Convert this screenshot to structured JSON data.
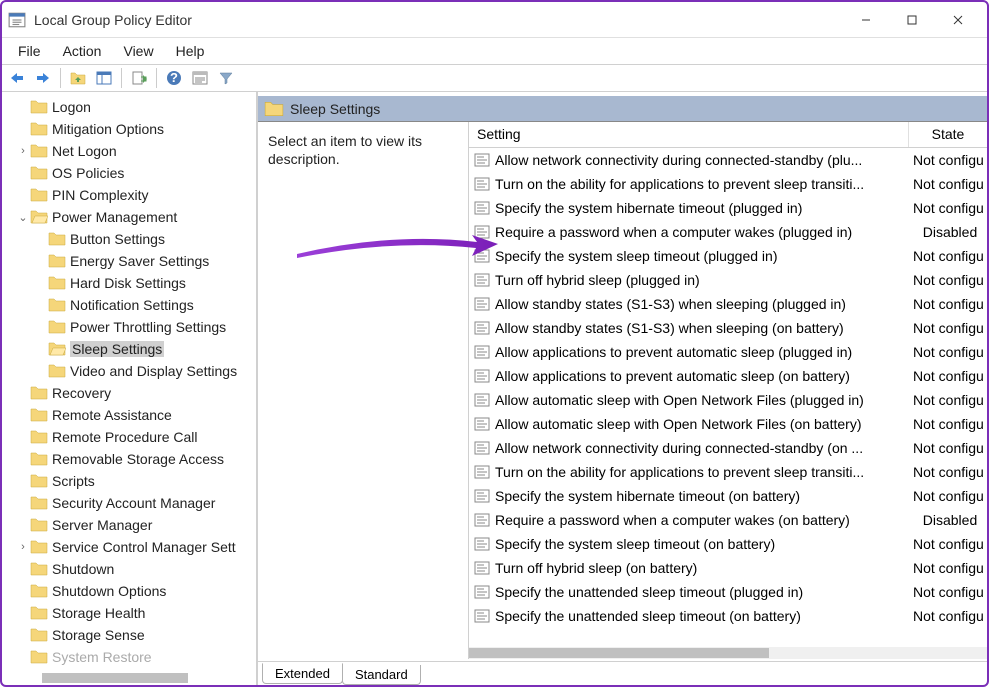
{
  "window": {
    "title": "Local Group Policy Editor"
  },
  "menu": [
    "File",
    "Action",
    "View",
    "Help"
  ],
  "section": {
    "title": "Sleep Settings",
    "description": "Select an item to view its description."
  },
  "columns": {
    "setting": "Setting",
    "state": "State"
  },
  "tree": [
    {
      "label": "Logon",
      "level": 1
    },
    {
      "label": "Mitigation Options",
      "level": 1
    },
    {
      "label": "Net Logon",
      "level": 1,
      "expand": "›"
    },
    {
      "label": "OS Policies",
      "level": 1
    },
    {
      "label": "PIN Complexity",
      "level": 1
    },
    {
      "label": "Power Management",
      "level": 1,
      "expand": "⌄",
      "open": true
    },
    {
      "label": "Button Settings",
      "level": 2
    },
    {
      "label": "Energy Saver Settings",
      "level": 2
    },
    {
      "label": "Hard Disk Settings",
      "level": 2
    },
    {
      "label": "Notification Settings",
      "level": 2
    },
    {
      "label": "Power Throttling Settings",
      "level": 2
    },
    {
      "label": "Sleep Settings",
      "level": 2,
      "selected": true,
      "open": true
    },
    {
      "label": "Video and Display Settings",
      "level": 2
    },
    {
      "label": "Recovery",
      "level": 1
    },
    {
      "label": "Remote Assistance",
      "level": 1
    },
    {
      "label": "Remote Procedure Call",
      "level": 1
    },
    {
      "label": "Removable Storage Access",
      "level": 1
    },
    {
      "label": "Scripts",
      "level": 1
    },
    {
      "label": "Security Account Manager",
      "level": 1
    },
    {
      "label": "Server Manager",
      "level": 1
    },
    {
      "label": "Service Control Manager Sett",
      "level": 1,
      "expand": "›"
    },
    {
      "label": "Shutdown",
      "level": 1
    },
    {
      "label": "Shutdown Options",
      "level": 1
    },
    {
      "label": "Storage Health",
      "level": 1
    },
    {
      "label": "Storage Sense",
      "level": 1
    },
    {
      "label": "System Restore",
      "level": 1,
      "dim": true
    }
  ],
  "settings": [
    {
      "name": "Allow network connectivity during connected-standby (plu...",
      "state": "Not configu"
    },
    {
      "name": "Turn on the ability for applications to prevent sleep transiti...",
      "state": "Not configu"
    },
    {
      "name": "Specify the system hibernate timeout (plugged in)",
      "state": "Not configu"
    },
    {
      "name": "Require a password when a computer wakes (plugged in)",
      "state": "Disabled",
      "centered": true
    },
    {
      "name": "Specify the system sleep timeout (plugged in)",
      "state": "Not configu"
    },
    {
      "name": "Turn off hybrid sleep (plugged in)",
      "state": "Not configu"
    },
    {
      "name": "Allow standby states (S1-S3) when sleeping (plugged in)",
      "state": "Not configu"
    },
    {
      "name": "Allow standby states (S1-S3) when sleeping (on battery)",
      "state": "Not configu"
    },
    {
      "name": "Allow applications to prevent automatic sleep (plugged in)",
      "state": "Not configu"
    },
    {
      "name": "Allow applications to prevent automatic sleep (on battery)",
      "state": "Not configu"
    },
    {
      "name": "Allow automatic sleep with Open Network Files (plugged in)",
      "state": "Not configu"
    },
    {
      "name": "Allow automatic sleep with Open Network Files (on battery)",
      "state": "Not configu"
    },
    {
      "name": "Allow network connectivity during connected-standby (on ...",
      "state": "Not configu"
    },
    {
      "name": "Turn on the ability for applications to prevent sleep transiti...",
      "state": "Not configu"
    },
    {
      "name": "Specify the system hibernate timeout (on battery)",
      "state": "Not configu"
    },
    {
      "name": "Require a password when a computer wakes (on battery)",
      "state": "Disabled",
      "centered": true
    },
    {
      "name": "Specify the system sleep timeout (on battery)",
      "state": "Not configu"
    },
    {
      "name": "Turn off hybrid sleep (on battery)",
      "state": "Not configu"
    },
    {
      "name": "Specify the unattended sleep timeout (plugged in)",
      "state": "Not configu"
    },
    {
      "name": "Specify the unattended sleep timeout (on battery)",
      "state": "Not configu"
    }
  ],
  "tabs": [
    "Extended",
    "Standard"
  ]
}
